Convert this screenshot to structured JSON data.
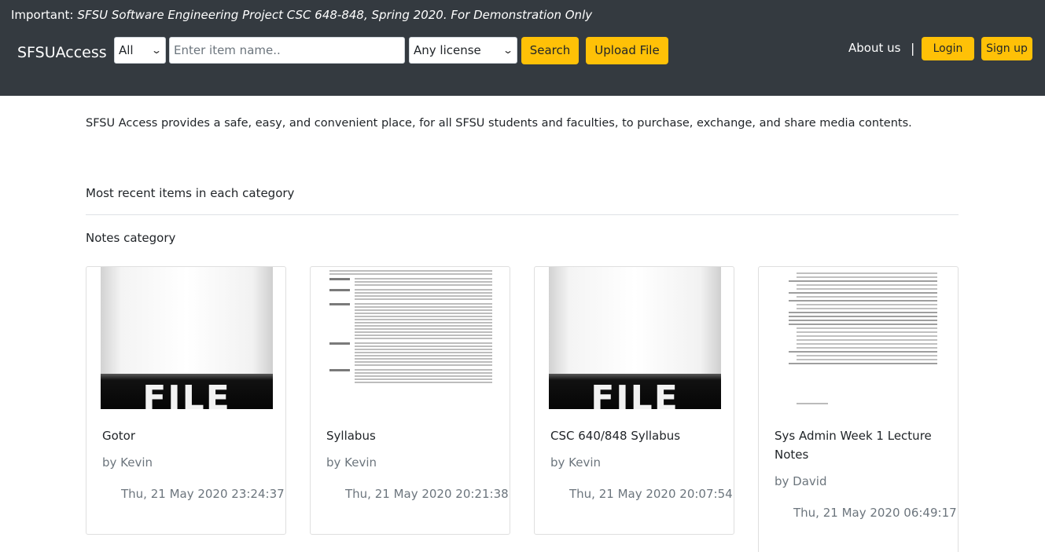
{
  "banner": {
    "label": "Important:",
    "text": "SFSU Software Engineering Project CSC 648-848, Spring 2020. For Demonstration Only"
  },
  "nav": {
    "brand": "SFSUAccess",
    "category_select": {
      "selected": "All"
    },
    "search_input": {
      "placeholder": "Enter item name..",
      "value": ""
    },
    "license_select": {
      "selected": "Any license"
    },
    "search_label": "Search",
    "upload_label": "Upload File",
    "about_label": "About us",
    "separator": "|",
    "login_label": "Login",
    "signup_label": "Sign up"
  },
  "main": {
    "intro": "SFSU Access provides a safe, easy, and convenient place, for all SFSU students and faculties, to purchase, exchange, and share media contents.",
    "recent_heading": "Most recent items in each category",
    "category_heading": "Notes category",
    "file_thumb_text": "FILE",
    "cards": [
      {
        "title": "Gotor",
        "author": "by Kevin",
        "date": "Thu, 21 May 2020 23:24:37",
        "thumbnail": "file-icon-image"
      },
      {
        "title": "Syllabus",
        "author": "by Kevin",
        "date": "Thu, 21 May 2020 20:21:38",
        "thumbnail": "document-page-image"
      },
      {
        "title": "CSC 640/848 Syllabus",
        "author": "by Kevin",
        "date": "Thu, 21 May 2020 20:07:54",
        "thumbnail": "file-icon-image"
      },
      {
        "title": "Sys Admin Week 1 Lecture Notes",
        "author": "by David",
        "date": "Thu, 21 May 2020 06:49:17",
        "thumbnail": "lecture-notes-image"
      }
    ]
  },
  "colors": {
    "header_bg": "#343a40",
    "accent": "#ffc107",
    "muted_text": "#6c757d"
  }
}
